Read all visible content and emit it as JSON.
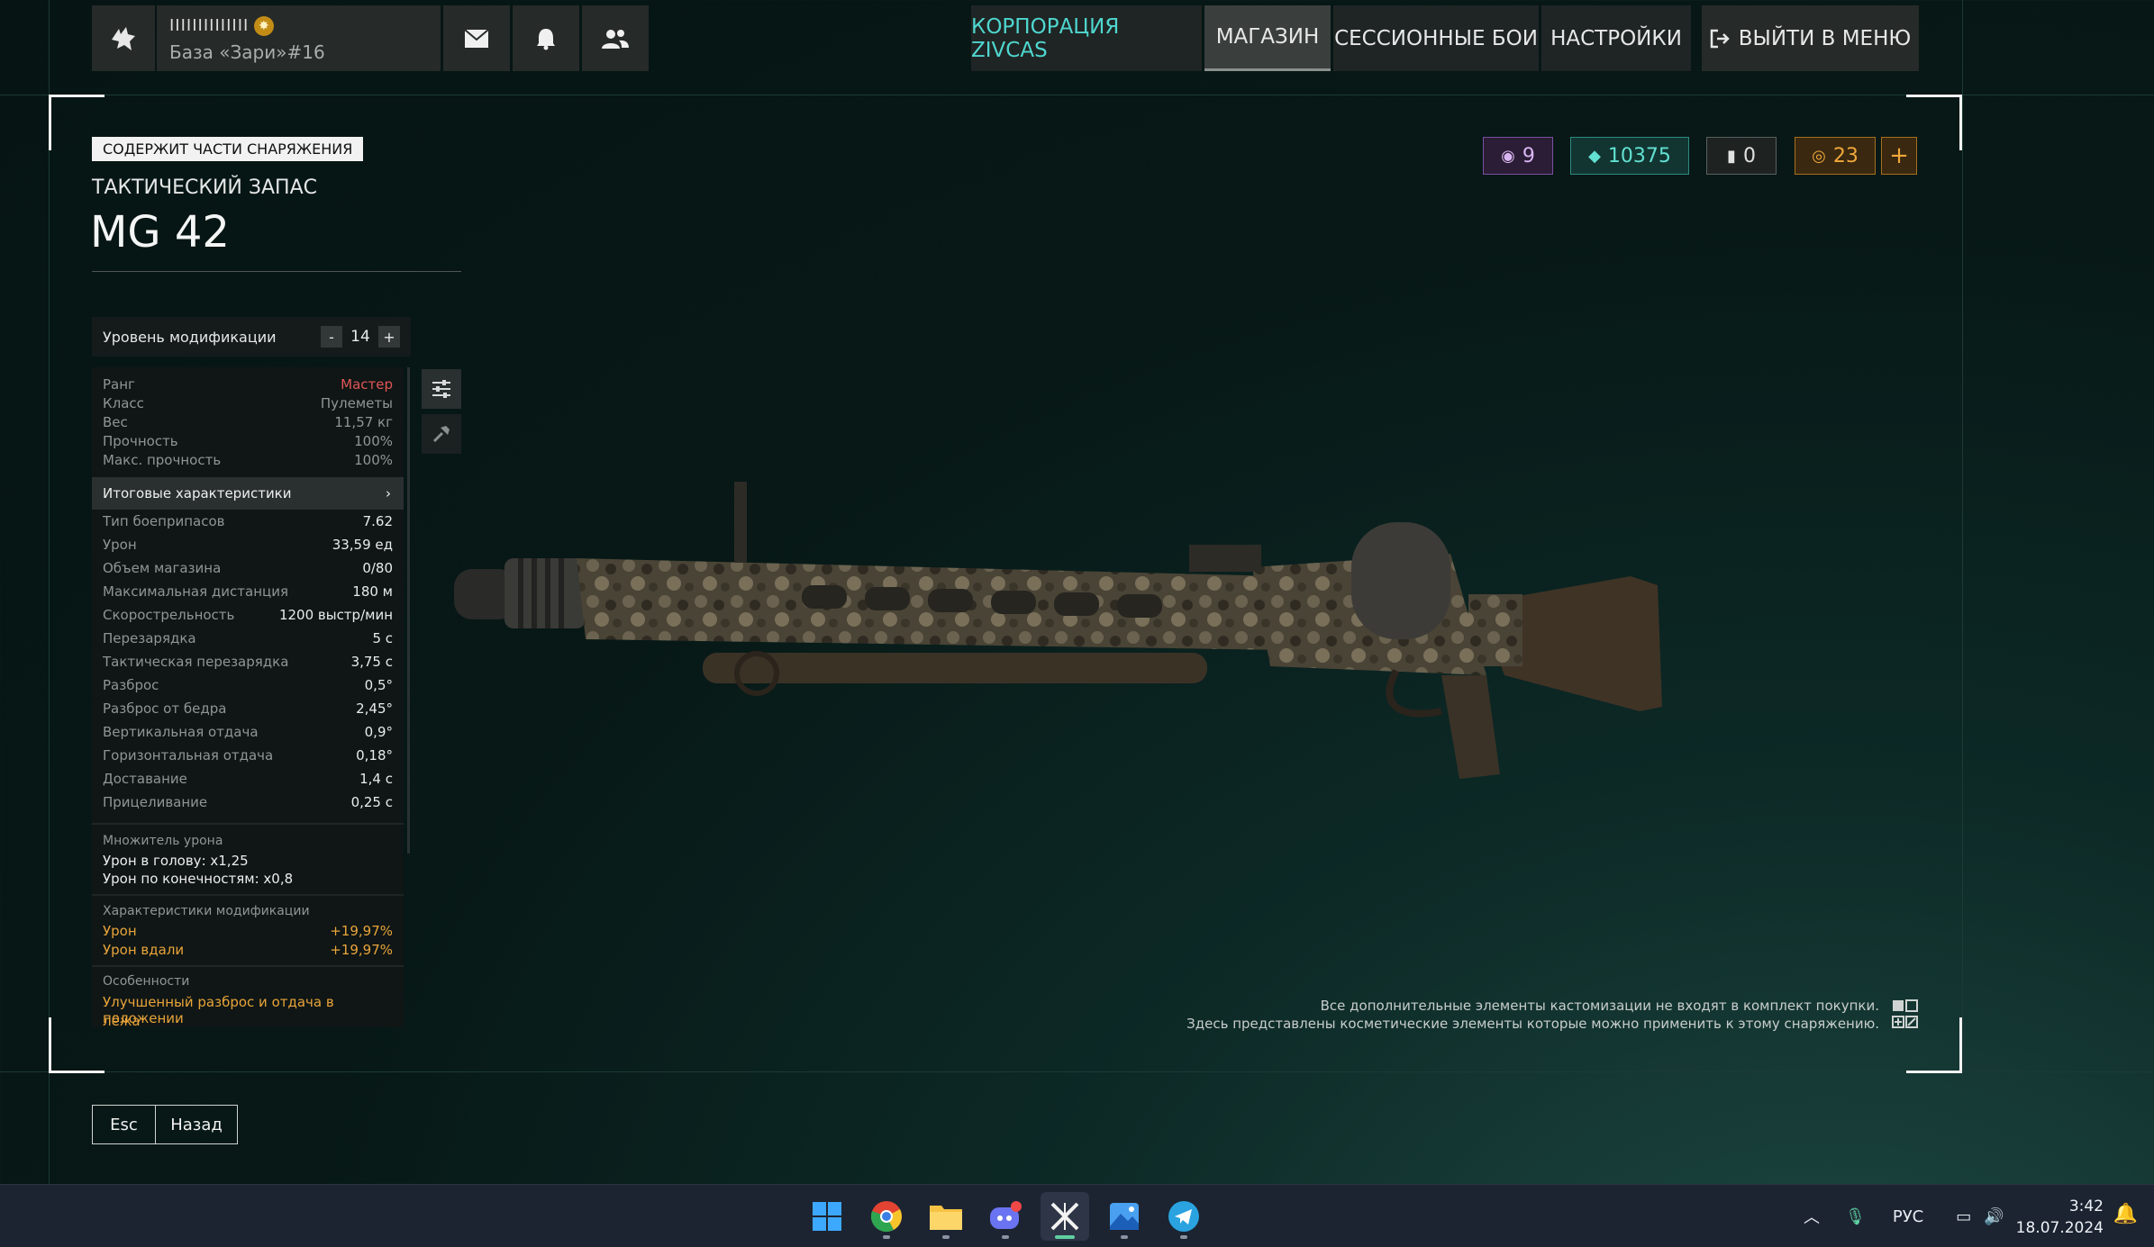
{
  "profile": {
    "nick": "IIIIIIIIIIIIII",
    "base": "База «Зари»#16"
  },
  "nav": {
    "corp": "КОРПОРАЦИЯ ZIVCAS",
    "shop": "МАГАЗИН",
    "session": "СЕССИОННЫЕ БОИ",
    "settings": "НАСТРОЙКИ",
    "exit": "ВЫЙТИ В МЕНЮ"
  },
  "item": {
    "tag": "СОДЕРЖИТ ЧАСТИ СНАРЯЖЕНИЯ",
    "category": "ТАКТИЧЕСКИЙ ЗАПАС",
    "name": "MG 42"
  },
  "mod_level": {
    "label": "Уровень модификации",
    "minus": "-",
    "value": "14",
    "plus": "+"
  },
  "basic": [
    {
      "k": "Ранг",
      "v": "Мастер"
    },
    {
      "k": "Класс",
      "v": "Пулеметы"
    },
    {
      "k": "Вес",
      "v": "11,57 кг"
    },
    {
      "k": "Прочность",
      "v": "100%"
    },
    {
      "k": "Макс. прочность",
      "v": "100%"
    }
  ],
  "final_header": "Итоговые характеристики",
  "final": [
    {
      "k": "Тип боеприпасов",
      "v": "7.62"
    },
    {
      "k": "Урон",
      "v": "33,59 ед"
    },
    {
      "k": "Объем магазина",
      "v": "0/80"
    },
    {
      "k": "Максимальная дистанция",
      "v": "180 м"
    },
    {
      "k": "Скорострельность",
      "v": "1200 выстр/мин"
    },
    {
      "k": "Перезарядка",
      "v": "5 с"
    },
    {
      "k": "Тактическая перезарядка",
      "v": "3,75 с"
    },
    {
      "k": "Разброс",
      "v": "0,5°"
    },
    {
      "k": "Разброс от бедра",
      "v": "2,45°"
    },
    {
      "k": "Вертикальная отдача",
      "v": "0,9°"
    },
    {
      "k": "Горизонтальная отдача",
      "v": "0,18°"
    },
    {
      "k": "Доставание",
      "v": "1,4 с"
    },
    {
      "k": "Прицеливание",
      "v": "0,25 с"
    }
  ],
  "damage_mult": {
    "title": "Множитель урона",
    "head": "Урон в голову: x1,25",
    "limbs": "Урон по конечностям: x0,8"
  },
  "mod_stats": {
    "title": "Характеристики модификации",
    "rows": [
      {
        "k": "Урон",
        "v": "+19,97%"
      },
      {
        "k": "Урон вдали",
        "v": "+19,97%"
      }
    ]
  },
  "features": {
    "title": "Особенности",
    "text1": "Улучшенный разброс и отдача в положении",
    "text2": "лёжа"
  },
  "currencies": {
    "purple": "9",
    "teal": "10375",
    "gray": "0",
    "gold": "23",
    "add": "+"
  },
  "disclaimer": {
    "line1": "Все дополнительные элементы кастомизации не входят в комплект покупки.",
    "line2": "Здесь представлены косметические элементы которые можно применить к этому снаряжению."
  },
  "bottom": {
    "esc": "Esc",
    "back": "Назад"
  },
  "taskbar": {
    "lang": "РУС",
    "time": "3:42",
    "date": "18.07.2024"
  }
}
